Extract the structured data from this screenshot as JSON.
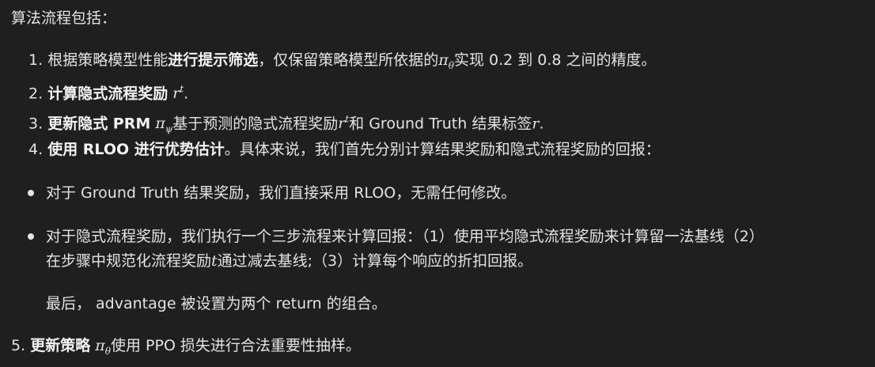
{
  "heading": "算法流程包括：",
  "steps": {
    "s1": {
      "num": "1.",
      "pre": "根据策略模型性能",
      "bold": "进行提示筛选",
      "mid": "，仅保留策略模型所依据的",
      "sym": "π",
      "sub": "θ",
      "post": "实现 0.2 到 0.8 之间的精度。"
    },
    "s2": {
      "num": "2.",
      "bold": "计算隐式流程奖励",
      "sym": "r",
      "sup": "t",
      "post": "."
    },
    "s3": {
      "num": "3.",
      "bold": "更新隐式 PRM",
      "sym": "π",
      "sub": "ψ",
      "mid": "基于预测的隐式流程奖励",
      "sym2": "r",
      "sup2": "t",
      "mid2": "和 Ground Truth 结果标签",
      "sym3": "r",
      "post": "."
    },
    "s4": {
      "num": "4.",
      "bold": "使用 RLOO 进行优势估计",
      "post": "。具体来说，我们首先分别计算结果奖励和隐式流程奖励的回报："
    },
    "s5": {
      "num": "5.",
      "bold": "更新策略",
      "sym": "π",
      "sub": "θ",
      "post": "使用 PPO 损失进行合法重要性抽样。"
    }
  },
  "bullets": {
    "b1": "对于 Ground Truth 结果奖励，我们直接采用 RLOO，无需任何修改。",
    "b2_line1": "对于隐式流程奖励，我们执行一个三步流程来计算回报：（1）使用平均隐式流程奖励来计算留一法基线（2）",
    "b2_line2_pre": "在步骤中规范化流程奖励",
    "b2_line2_sym": "t",
    "b2_line2_post": "通过减去基线;（3）计算每个响应的折扣回报。"
  },
  "final_note": "最后， advantage 被设置为两个 return 的组合。"
}
